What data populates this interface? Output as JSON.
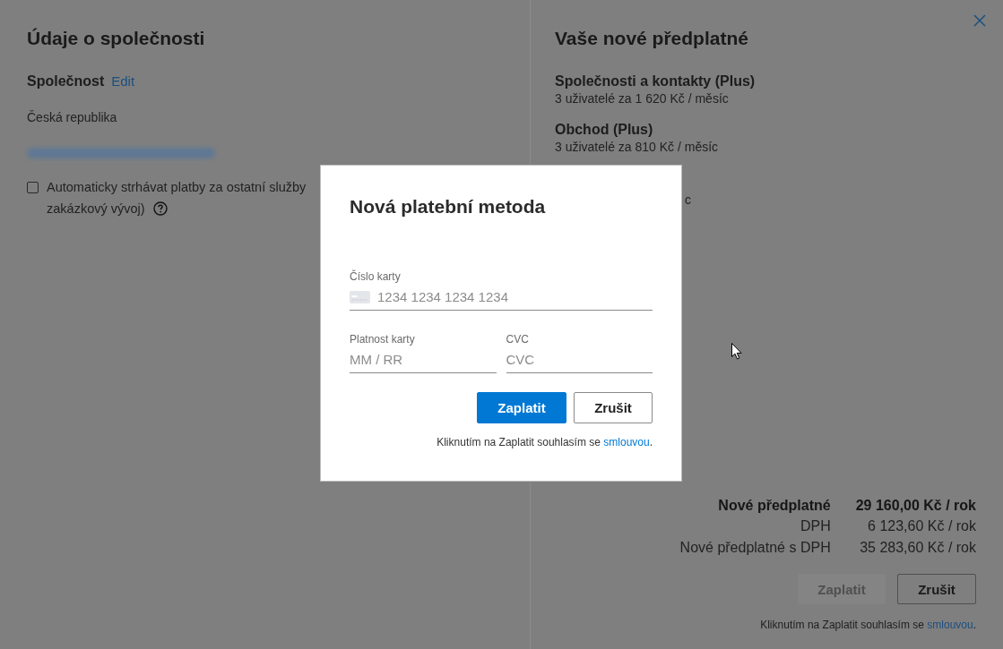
{
  "company_panel": {
    "title": "Údaje o společnosti",
    "section_title": "Společnost",
    "edit_link": "Edit",
    "country": "Česká republika",
    "auto_charge": {
      "checked": false,
      "label_lines": [
        "Automaticky strhávat platby za ostatní služby",
        "zakázkový vývoj)"
      ]
    }
  },
  "subscription_panel": {
    "title": "Vaše nové předplatné",
    "products": [
      {
        "name": "Společnosti a kontakty (Plus)",
        "detail": "3 uživatelé za 1 620 Kč / měsíc"
      },
      {
        "name": "Obchod (Plus)",
        "detail": "3 uživatelé za 810 Kč / měsíc"
      }
    ],
    "covered_text_fragment": "c",
    "totals": [
      {
        "kind": "total",
        "label": "Nové předplatné",
        "value": "29 160,00 Kč / rok"
      },
      {
        "kind": "line",
        "label": "DPH",
        "value": "6 123,60 Kč / rok"
      },
      {
        "kind": "line",
        "label": "Nové předplatné s DPH",
        "value": "35 283,60 Kč / rok"
      }
    ],
    "buttons": [
      {
        "kind": "primary",
        "label": "Zaplatit",
        "disabled": true
      },
      {
        "kind": "secondary",
        "label": "Zrušit",
        "disabled": false
      }
    ],
    "agreement": {
      "text": "Kliknutím na Zaplatit souhlasím se",
      "link": "smlouvou",
      "end": "."
    }
  },
  "dialog": {
    "title": "Nová platební metoda",
    "card_number": {
      "label": "Číslo karty",
      "placeholder": "1234 1234 1234 1234"
    },
    "expiry": {
      "label": "Platnost karty",
      "placeholder": "MM / RR"
    },
    "cvc": {
      "label": "CVC",
      "placeholder": "CVC"
    },
    "buttons": [
      {
        "kind": "primary",
        "label": "Zaplatit",
        "disabled": false
      },
      {
        "kind": "secondary",
        "label": "Zrušit",
        "disabled": false
      }
    ],
    "agreement": {
      "text": "Kliknutím na Zaplatit souhlasím se",
      "link": "smlouvou",
      "end": "."
    }
  }
}
